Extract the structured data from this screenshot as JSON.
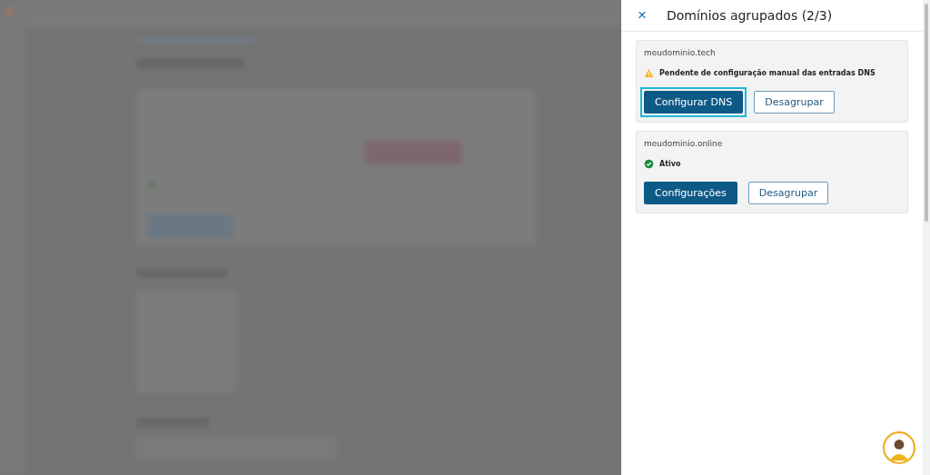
{
  "panel": {
    "close_icon": "×",
    "title": "Domínios agrupados (2/3)"
  },
  "domains": [
    {
      "name": "meudominio.tech",
      "status": {
        "kind": "warning",
        "text": "Pendente de configuração manual das entradas DNS"
      },
      "primary_button": {
        "label": "Configurar DNS",
        "focused": true
      },
      "secondary_button": {
        "label": "Desagrupar"
      }
    },
    {
      "name": "meudominio.online",
      "status": {
        "kind": "success",
        "text": "Ativo"
      },
      "primary_button": {
        "label": "Configurações",
        "focused": false
      },
      "secondary_button": {
        "label": "Desagrupar"
      }
    }
  ]
}
